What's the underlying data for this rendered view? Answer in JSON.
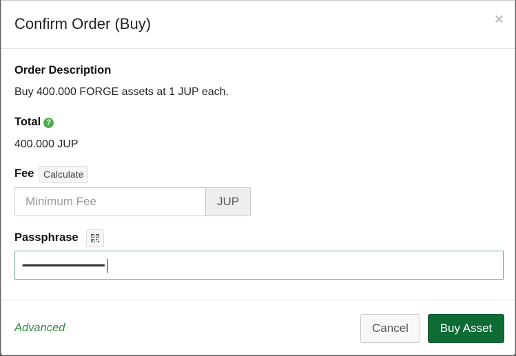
{
  "modal": {
    "title": "Confirm Order (Buy)",
    "close_symbol": "×"
  },
  "order_description": {
    "label": "Order Description",
    "text": "Buy 400.000 FORGE assets at 1 JUP each."
  },
  "total": {
    "label": "Total",
    "help_icon": "question-circle-icon",
    "help_symbol": "?",
    "value": "400.000 JUP"
  },
  "fee": {
    "label": "Fee",
    "calculate_label": "Calculate",
    "placeholder": "Minimum Fee",
    "value": "",
    "unit": "JUP"
  },
  "passphrase": {
    "label": "Passphrase",
    "qr_icon": "qr-code-icon",
    "masked_value": "••••••••••••••••••••••••••••••••••••••••••••••••••••••••••••••••••••••••••••••••••••••••••••••••••"
  },
  "footer": {
    "advanced_label": "Advanced",
    "cancel_label": "Cancel",
    "submit_label": "Buy Asset"
  },
  "colors": {
    "accent_green": "#0f6b35",
    "link_green": "#2e8b3e",
    "help_green": "#4cae4c"
  }
}
